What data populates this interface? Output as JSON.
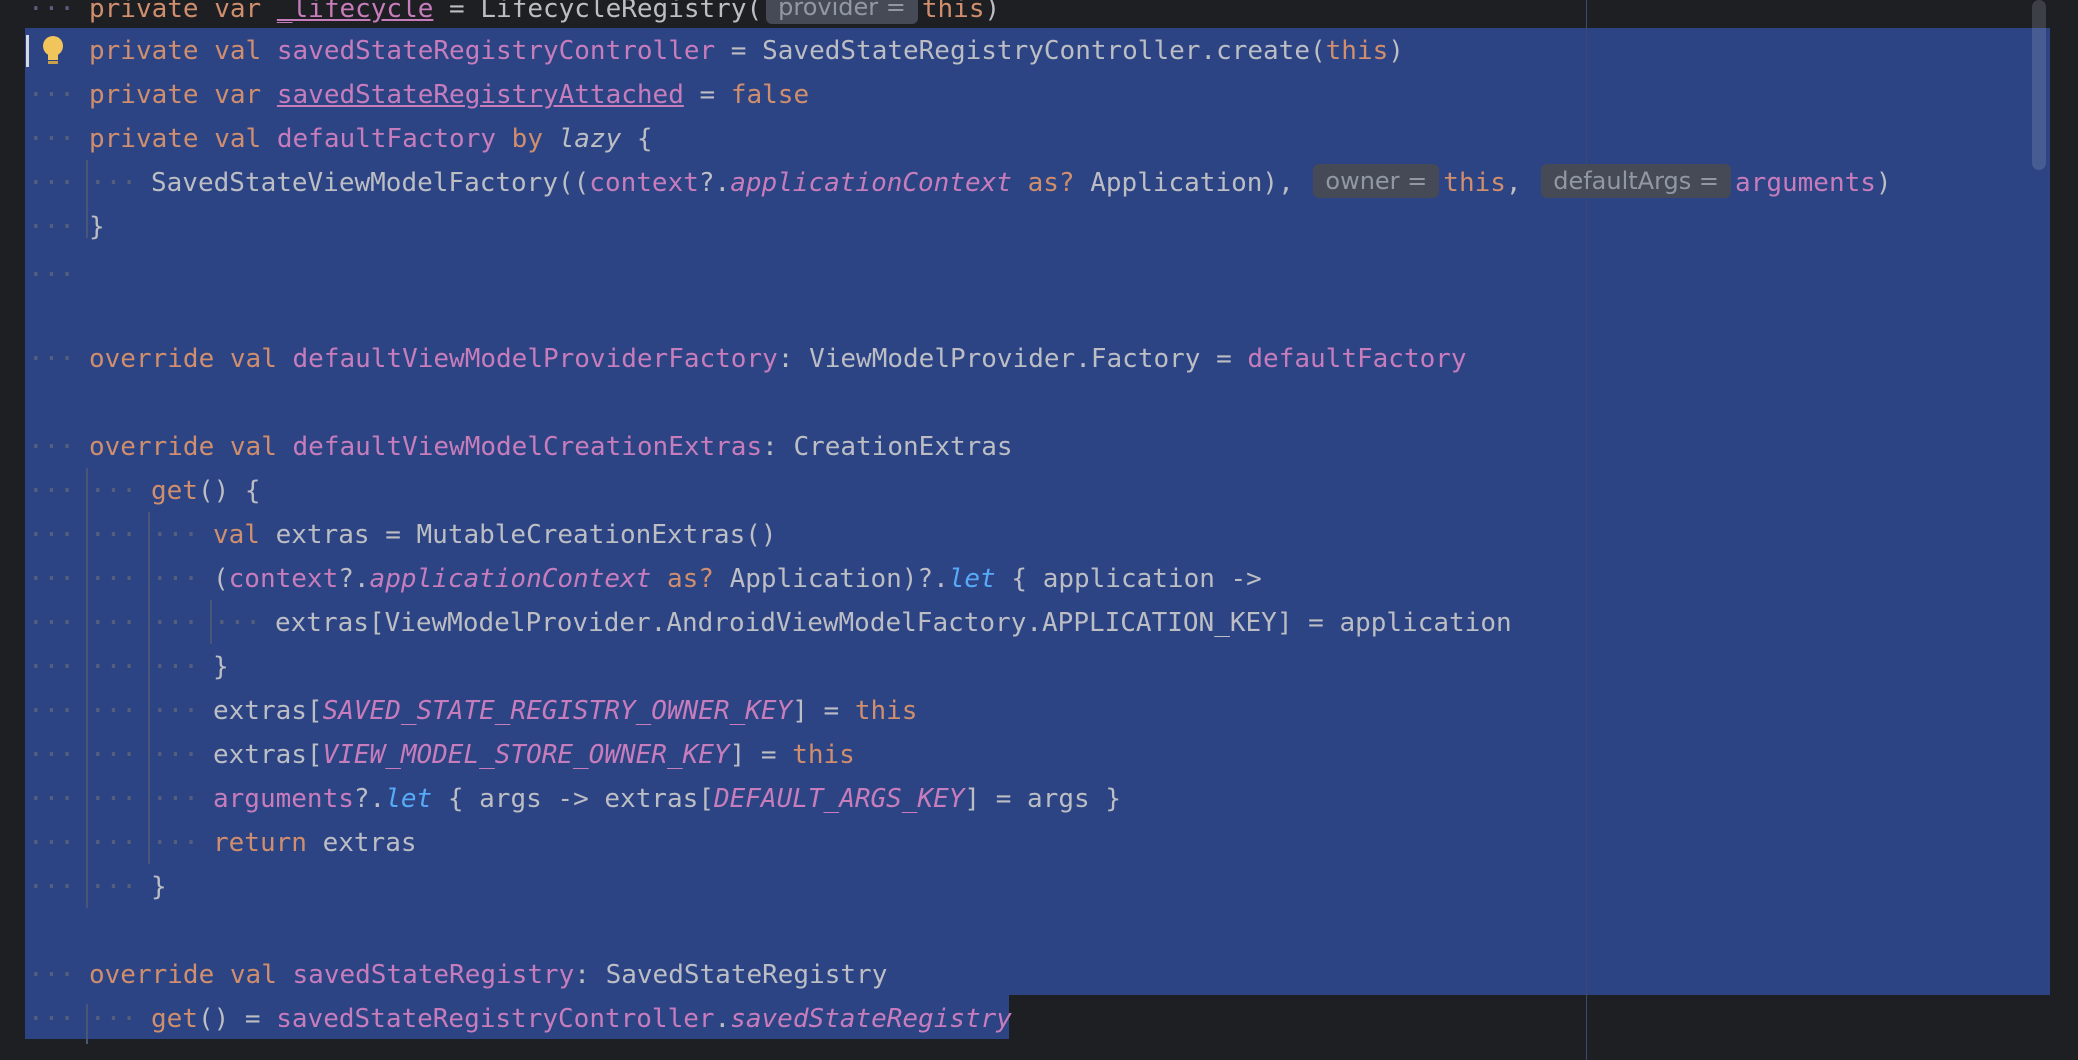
{
  "editor": {
    "indent_dots": "····",
    "fold_dots": "···",
    "hints": {
      "provider": "provider =",
      "owner": "owner =",
      "defaultArgs": "defaultArgs ="
    },
    "colors": {
      "background": "#1e1f22",
      "selection": "#2c4384",
      "keyword": "#cf8e6d",
      "property": "#c77dbb",
      "extension": "#57aaf7",
      "text": "#bcbec4",
      "bulb": "#f2c55c"
    },
    "icons": {
      "intention": "lightbulb-icon"
    },
    "tokens": {
      "private": "private",
      "var": "var",
      "val": "val",
      "override": "override",
      "by": "by",
      "lazy": "lazy",
      "return": "return",
      "this": "this",
      "false": "false",
      "as": "as?",
      "let": "let",
      "get": "get",
      "lifecycle": "_lifecycle",
      "LifecycleRegistry": "LifecycleRegistry(",
      "savedStateRegistryController": "savedStateRegistryController",
      "SavedStateRegistryControllerCreate": "SavedStateRegistryController.create(",
      "savedStateRegistryAttached": "savedStateRegistryAttached",
      "defaultFactory": "defaultFactory",
      "SavedStateViewModelFactory": "SavedStateViewModelFactory((",
      "context": "context",
      "applicationContext": "applicationContext",
      "Application": "Application",
      "arguments": "arguments",
      "defaultViewModelProviderFactory": "defaultViewModelProviderFactory",
      "ViewModelProviderFactory": "ViewModelProvider.Factory",
      "defaultViewModelCreationExtras": "defaultViewModelCreationExtras",
      "CreationExtras": "CreationExtras",
      "extras": "extras",
      "MutableCreationExtras": "MutableCreationExtras()",
      "application": "application",
      "applicationKey": "extras[ViewModelProvider.AndroidViewModelFactory.APPLICATION_KEY]",
      "SAVED_STATE_REGISTRY_OWNER_KEY": "SAVED_STATE_REGISTRY_OWNER_KEY",
      "VIEW_MODEL_STORE_OWNER_KEY": "VIEW_MODEL_STORE_OWNER_KEY",
      "DEFAULT_ARGS_KEY": "DEFAULT_ARGS_KEY",
      "args": "args",
      "savedStateRegistry": "savedStateRegistry",
      "SavedStateRegistry": "SavedStateRegistry"
    }
  }
}
